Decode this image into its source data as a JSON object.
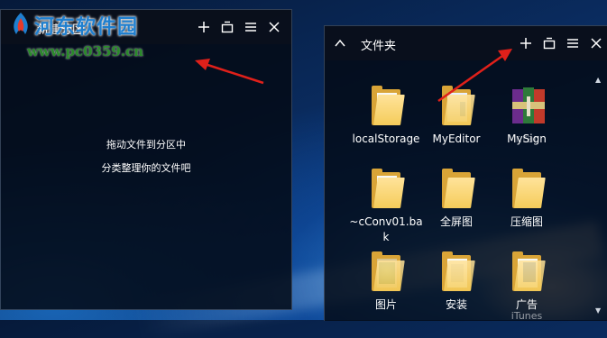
{
  "watermark": {
    "title": "河东软件园",
    "url": "www.pc0359.cn"
  },
  "left_panel": {
    "title": "新建分区",
    "message_line1": "拖动文件到分区中",
    "message_line2": "分类整理你的文件吧",
    "buttons": [
      "plus-icon",
      "window-icon",
      "menu-icon",
      "close-icon"
    ]
  },
  "right_panel": {
    "title": "文件夹",
    "buttons": [
      "chevron-up-icon",
      "plus-icon",
      "window-icon",
      "menu-icon",
      "close-icon"
    ],
    "items": [
      {
        "label": "localStorage",
        "icon": "folder-icon"
      },
      {
        "label": "MyEditor",
        "icon": "folder-icon"
      },
      {
        "label": "MySign",
        "label_ghost": "r.rar",
        "icon": "rar-archive-icon"
      },
      {
        "label": "~cConv01.bak",
        "icon": "folder-icon"
      },
      {
        "label": "全屏图",
        "icon": "folder-icon"
      },
      {
        "label": "压缩图",
        "icon": "folder-icon"
      },
      {
        "label": "图片",
        "icon": "folder-icon"
      },
      {
        "label": "安装",
        "icon": "folder-icon"
      },
      {
        "label": "广告",
        "label_ghost": "iTunes",
        "icon": "folder-icon"
      }
    ]
  },
  "colors": {
    "panel_bg": "#040a16",
    "folder_yellow": "#f5cc5a",
    "arrow_red": "#e0201a",
    "watermark_blue": "#1f7fcf",
    "watermark_green": "#2a8a2a"
  }
}
